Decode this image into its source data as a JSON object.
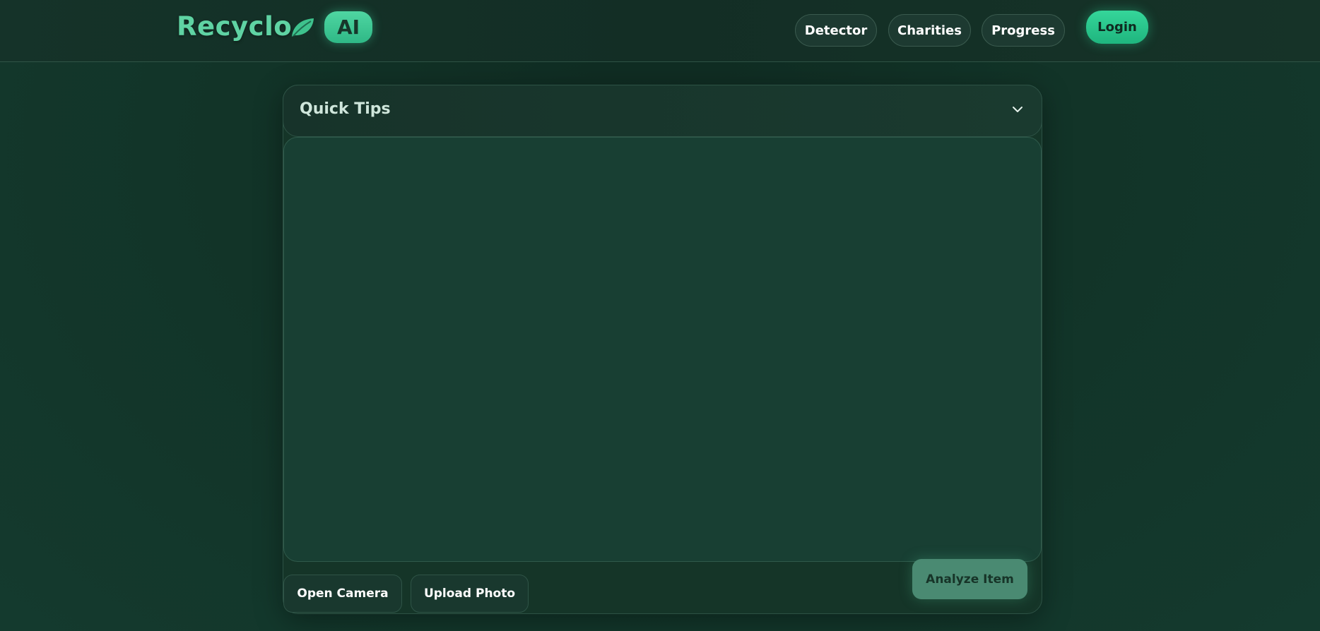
{
  "header": {
    "logo_text": "Recyclo",
    "logo_icon": "leaf-icon",
    "ai_badge": "AI",
    "nav": [
      "Detector",
      "Charities",
      "Progress"
    ],
    "login_label": "Login"
  },
  "tips": {
    "title": "Quick Tips",
    "toggle_icon": "chevron-down-icon"
  },
  "actions": {
    "open_camera": "Open Camera",
    "upload_photo": "Upload Photo",
    "analyze": "Analyze Item"
  },
  "colors": {
    "accent": "#2fc48e",
    "background": "#133428",
    "logo": "#5fd3a3"
  }
}
